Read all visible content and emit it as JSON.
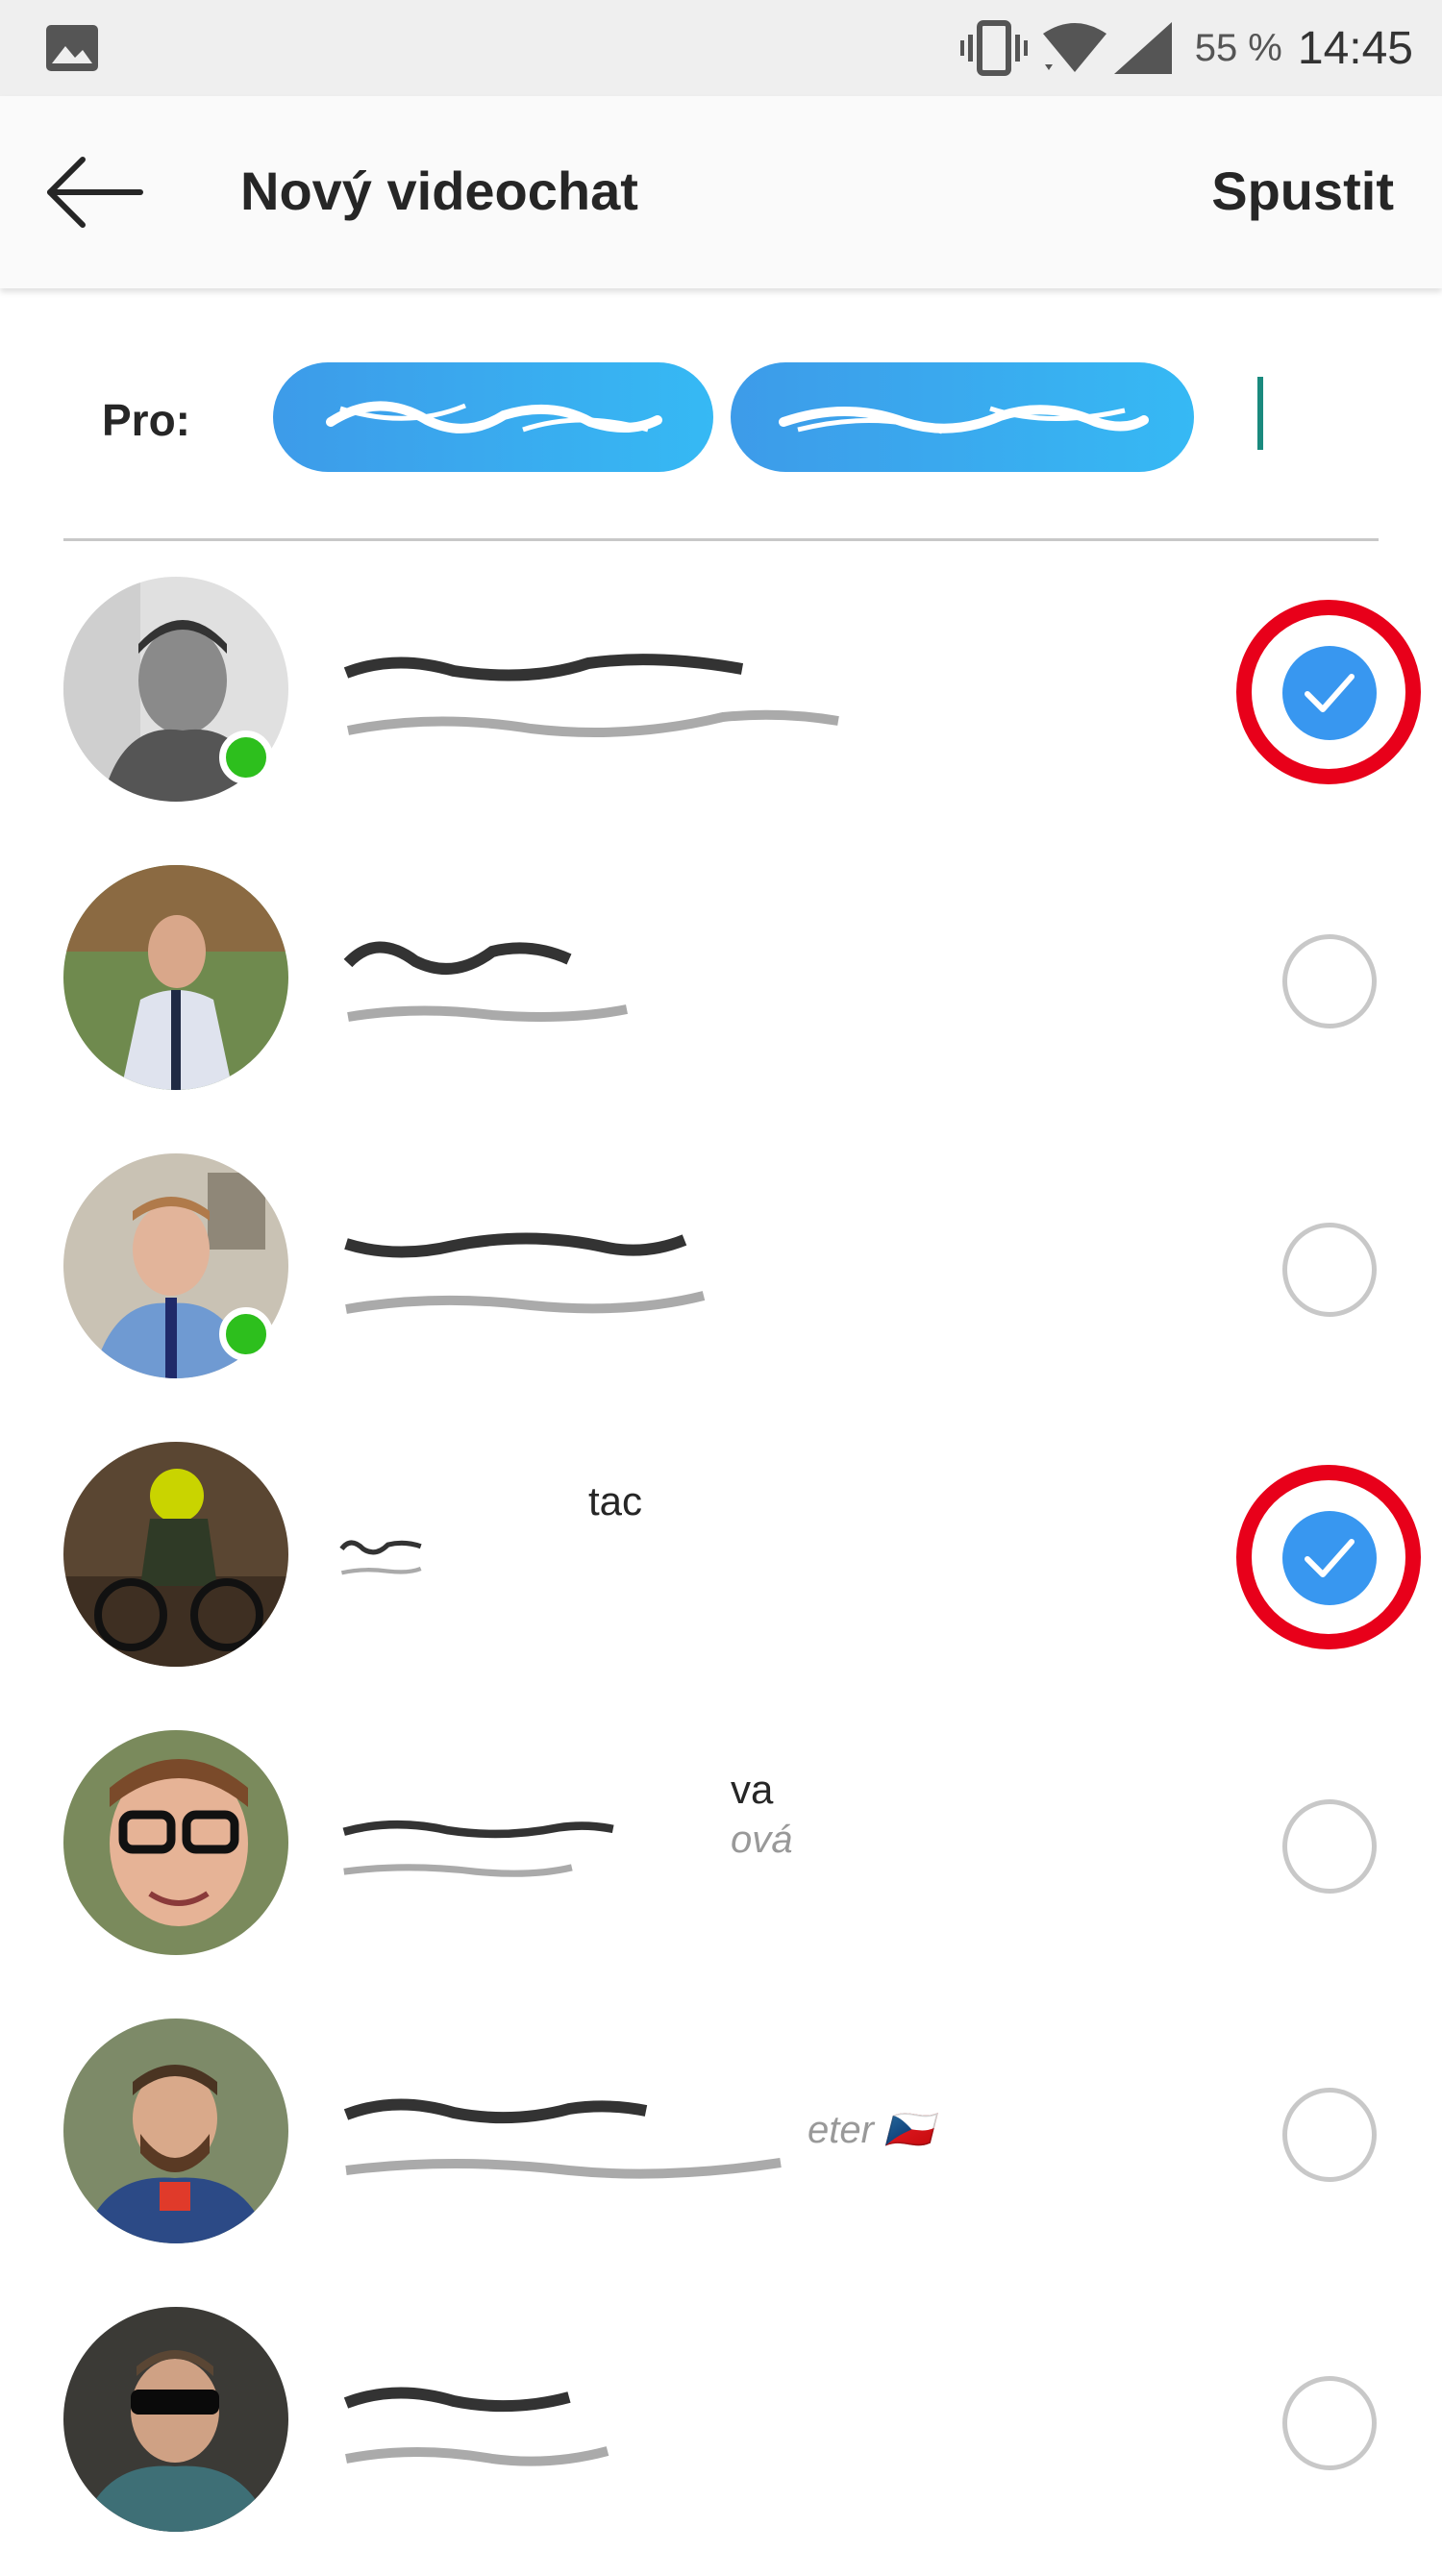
{
  "status_bar": {
    "battery": "55 %",
    "time": "14:45",
    "icons": [
      "image-icon",
      "vibrate-icon",
      "wifi-icon",
      "signal-icon"
    ]
  },
  "header": {
    "title": "Nový videochat",
    "start_label": "Spustit",
    "back_icon": "arrow-left-icon"
  },
  "to_row": {
    "label": "Pro:",
    "chips_count": 2
  },
  "contacts": [
    {
      "name": "",
      "subtitle": "",
      "online": true,
      "selected": true
    },
    {
      "name": "",
      "subtitle": "",
      "online": false,
      "selected": false
    },
    {
      "name": "",
      "subtitle": "",
      "online": true,
      "selected": false
    },
    {
      "name": "tac",
      "subtitle": "",
      "online": false,
      "selected": true
    },
    {
      "name": "va",
      "subtitle": "ová",
      "online": false,
      "selected": false
    },
    {
      "name": "",
      "subtitle": "eter 🇨🇿",
      "online": false,
      "selected": false
    },
    {
      "name": "",
      "subtitle": "",
      "online": false,
      "selected": false
    }
  ],
  "colors": {
    "accent_blue": "#3897f0",
    "chip_gradient_start": "#3d9be9",
    "chip_gradient_end": "#36b9f4",
    "online_green": "#2dbf1d",
    "highlight_red": "#e8001a",
    "cursor_teal": "#1a8a7e"
  }
}
